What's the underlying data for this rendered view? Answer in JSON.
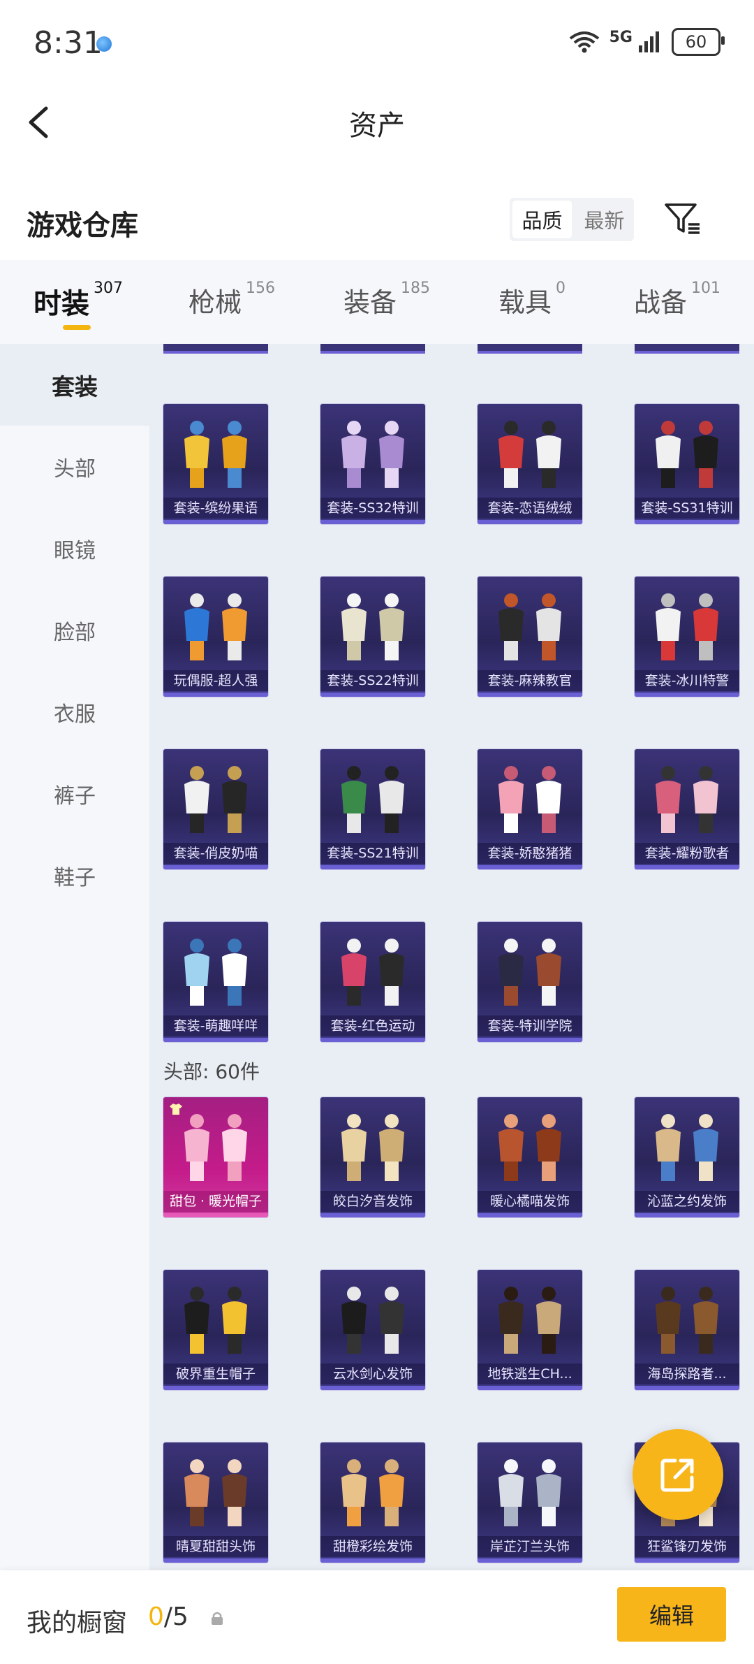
{
  "status_bar": {
    "time": "8:31",
    "network": "5G",
    "battery": "60"
  },
  "header": {
    "title": "资产"
  },
  "warehouse": {
    "title": "游戏仓库",
    "sort_options": [
      "品质",
      "最新"
    ],
    "active_sort": "品质"
  },
  "category_tabs": [
    {
      "label": "时装",
      "count": "307",
      "active": true
    },
    {
      "label": "枪械",
      "count": "156",
      "active": false
    },
    {
      "label": "装备",
      "count": "185",
      "active": false
    },
    {
      "label": "载具",
      "count": "0",
      "active": false
    },
    {
      "label": "战备",
      "count": "101",
      "active": false
    }
  ],
  "sidebar": {
    "items": [
      {
        "label": "套装",
        "active": true
      },
      {
        "label": "头部",
        "active": false
      },
      {
        "label": "眼镜",
        "active": false
      },
      {
        "label": "脸部",
        "active": false
      },
      {
        "label": "衣服",
        "active": false
      },
      {
        "label": "裤子",
        "active": false
      },
      {
        "label": "鞋子",
        "active": false
      }
    ]
  },
  "suit_items": [
    "套装-缤纷果语",
    "套装-SS32特训",
    "套装-恋语绒绒",
    "套装-SS31特训",
    "玩偶服-超人强",
    "套装-SS22特训",
    "套装-麻辣教官",
    "套装-冰川特警",
    "套装-俏皮奶喵",
    "套装-SS21特训",
    "套装-娇憨猪猪",
    "套装-耀粉歌者",
    "套装-萌趣咩咩",
    "套装-红色运动",
    "套装-特训学院"
  ],
  "head_section": {
    "title": "头部: 60件"
  },
  "head_items": [
    {
      "label": "甜包 · 暖光帽子",
      "rarity": "pink"
    },
    {
      "label": "皎白汐音发饰",
      "rarity": "purple"
    },
    {
      "label": "暖心橘喵发饰",
      "rarity": "purple"
    },
    {
      "label": "沁蓝之约发饰",
      "rarity": "purple"
    },
    {
      "label": "破界重生帽子",
      "rarity": "purple"
    },
    {
      "label": "云水剑心发饰",
      "rarity": "purple"
    },
    {
      "label": "地铁逃生CH...",
      "rarity": "purple"
    },
    {
      "label": "海岛探路者...",
      "rarity": "purple"
    },
    {
      "label": "晴夏甜甜头饰",
      "rarity": "purple"
    },
    {
      "label": "甜橙彩绘发饰",
      "rarity": "purple"
    },
    {
      "label": "岸芷汀兰头饰",
      "rarity": "purple"
    },
    {
      "label": "狂鲨锋刃发饰",
      "rarity": "purple"
    }
  ],
  "bottom_bar": {
    "label": "我的橱窗",
    "used": "0",
    "total": "/5",
    "edit_label": "编辑"
  },
  "colors": {
    "accent": "#f7b519",
    "card_purple": "#3b3377",
    "card_pink": "#c41b8a"
  }
}
